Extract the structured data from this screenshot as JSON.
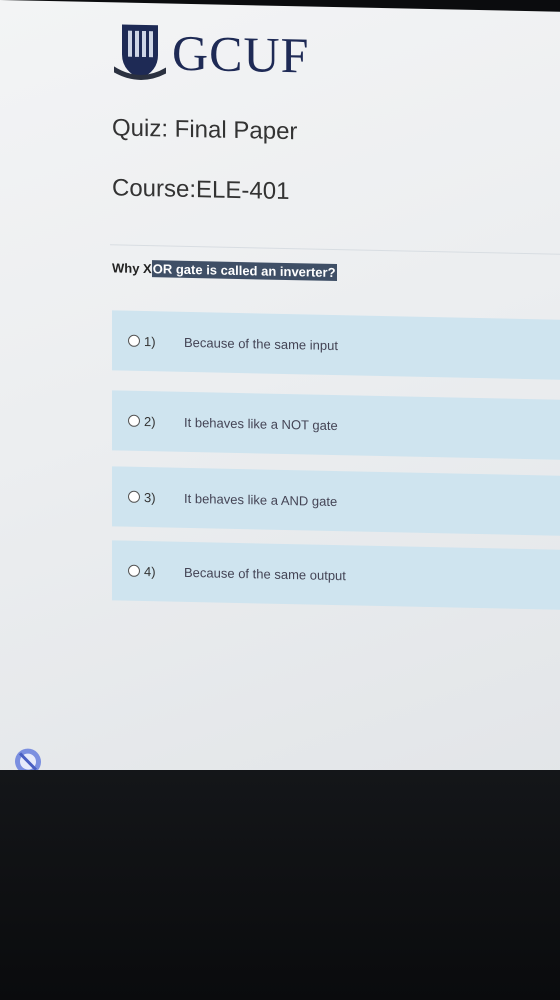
{
  "header": {
    "logo_text": "GCUF"
  },
  "quiz": {
    "title": "Quiz: Final Paper",
    "course": "Course:ELE-401"
  },
  "question": {
    "prefix": "Why X",
    "highlighted": "OR gate is called an inverter?"
  },
  "options": [
    {
      "num": "1)",
      "text": "Because of the same input"
    },
    {
      "num": "2)",
      "text": "It behaves like a NOT gate"
    },
    {
      "num": "3)",
      "text": "It behaves like a AND gate"
    },
    {
      "num": "4)",
      "text": "Because of the same output"
    }
  ],
  "colors": {
    "option_bg": "#cfe4ef",
    "logo": "#1e2a55",
    "highlight": "#3f4f66"
  }
}
